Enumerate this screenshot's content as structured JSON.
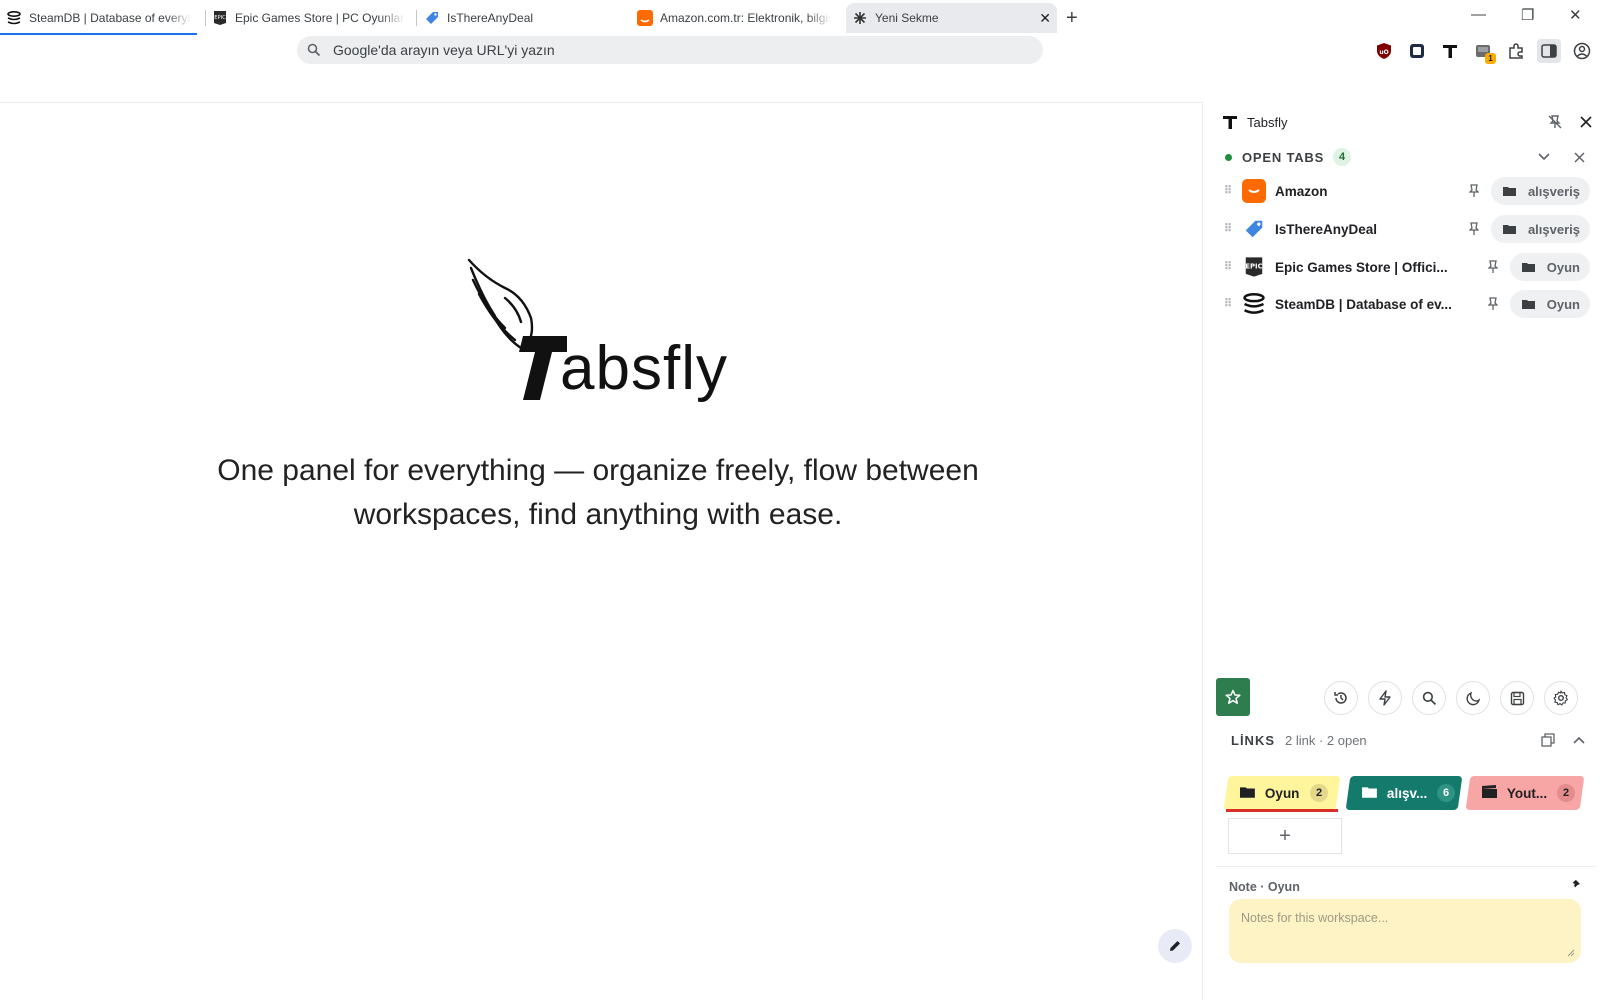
{
  "tabs": [
    {
      "title": "SteamDB | Database of everything",
      "favicon": "steamdb-icon"
    },
    {
      "title": "Epic Games Store | PC Oyunlarını",
      "favicon": "epic-icon"
    },
    {
      "title": "IsThereAnyDeal",
      "favicon": "isthereanydeal-icon"
    },
    {
      "title": "Amazon.com.tr: Elektronik, bilgisa",
      "favicon": "amazon-icon"
    },
    {
      "title": "Yeni Sekme",
      "favicon": "new-tab-icon",
      "active": true
    }
  ],
  "omnibox": {
    "placeholder": "Google'da arayın veya URL'yi yazın"
  },
  "extensions": {
    "badge_count": "1"
  },
  "hero": {
    "logo_text": "absfly",
    "tagline_line1": "One panel for everything — organize freely, flow between",
    "tagline_line2": "workspaces, find anything with ease."
  },
  "panel": {
    "title": "Tabsfly",
    "open_tabs": {
      "label": "OPEN TABS",
      "count": "4",
      "items": [
        {
          "title": "Amazon",
          "workspace": "alışveriş",
          "favicon": "amazon-icon"
        },
        {
          "title": "IsThereAnyDeal",
          "workspace": "alışveriş",
          "favicon": "isthereanydeal-icon"
        },
        {
          "title": "Epic Games Store | Offici...",
          "workspace": "Oyun",
          "favicon": "epic-icon"
        },
        {
          "title": "SteamDB | Database of ev...",
          "workspace": "Oyun",
          "favicon": "steamdb-icon"
        }
      ]
    },
    "links": {
      "label": "LİNKS",
      "summary": "2 link · 2 open"
    },
    "workspaces": [
      {
        "name": "Oyun",
        "count": "2",
        "color": "#fff59d",
        "icon": "folder-icon"
      },
      {
        "name": "alışv...",
        "count": "6",
        "color": "#137a6c",
        "icon": "folder-icon"
      },
      {
        "name": "Yout...",
        "count": "2",
        "color": "#f8a5a5",
        "icon": "clapperboard-icon"
      }
    ],
    "note": {
      "label": "Note · Oyun",
      "placeholder": "Notes for this workspace..."
    }
  },
  "colors": {
    "accent": "#1a73e8",
    "panel_green": "#2e7d4f",
    "note_bg": "#fdf3c4"
  }
}
